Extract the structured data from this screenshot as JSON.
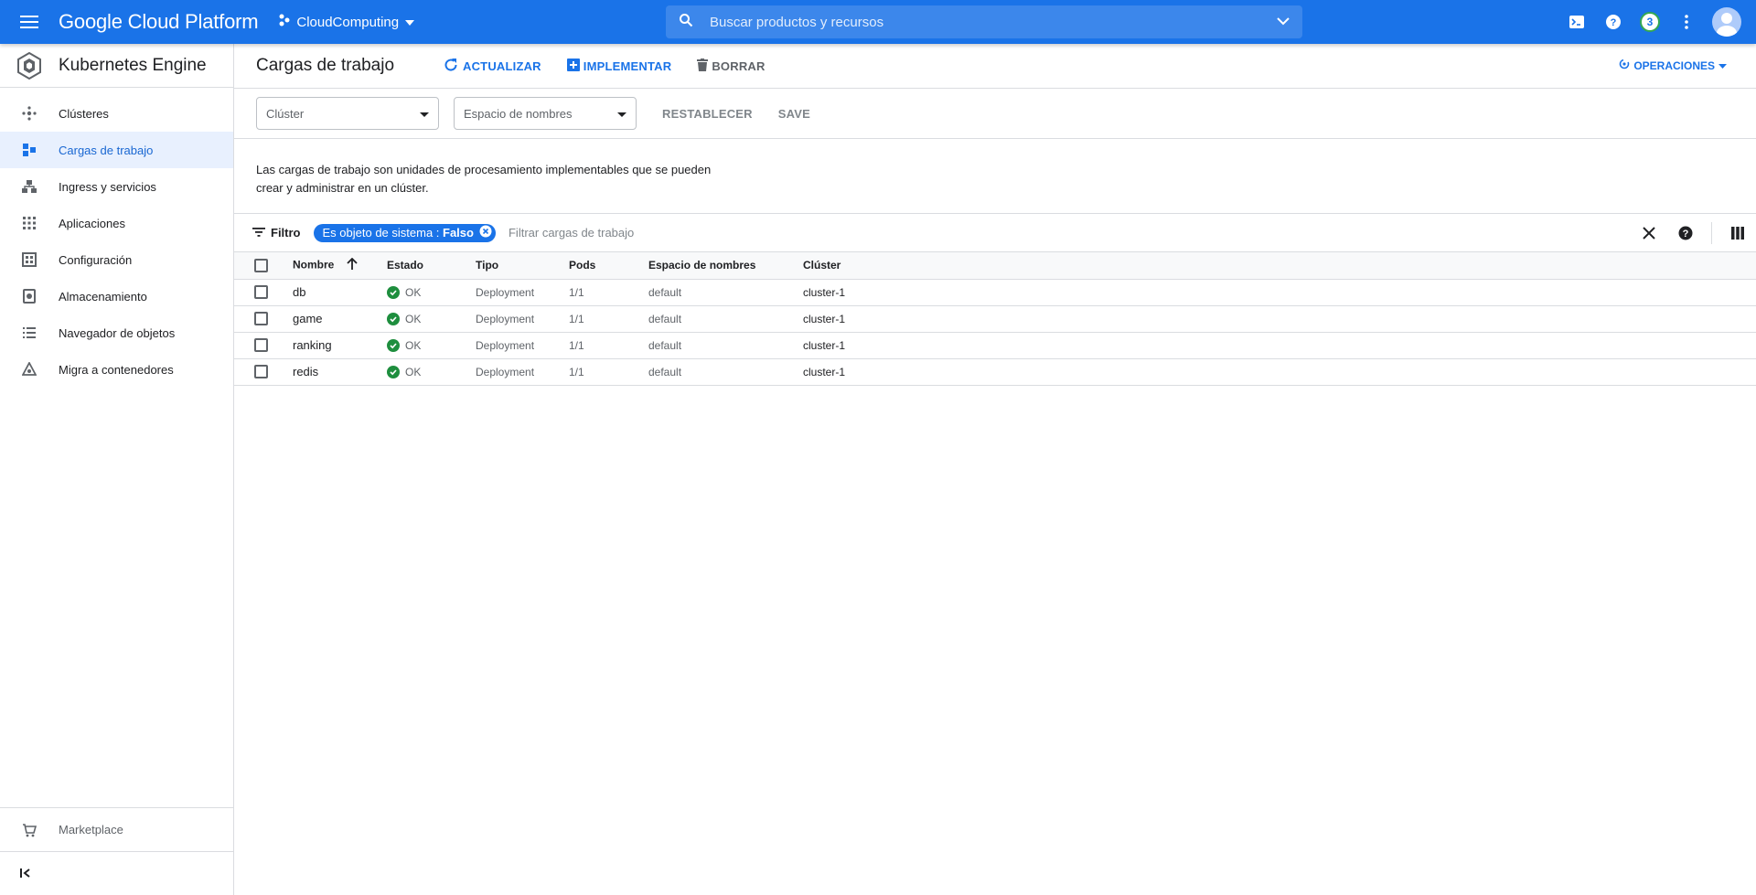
{
  "topbar": {
    "brand": "Google Cloud Platform",
    "project": "CloudComputing",
    "search_placeholder": "Buscar productos y recursos",
    "notification_count": "3"
  },
  "sidebar": {
    "title": "Kubernetes Engine",
    "items": [
      {
        "label": "Clústeres",
        "icon": "clusters-icon"
      },
      {
        "label": "Cargas de trabajo",
        "icon": "workloads-icon",
        "active": true
      },
      {
        "label": "Ingress y servicios",
        "icon": "services-icon"
      },
      {
        "label": "Aplicaciones",
        "icon": "apps-icon"
      },
      {
        "label": "Configuración",
        "icon": "config-icon"
      },
      {
        "label": "Almacenamiento",
        "icon": "storage-icon"
      },
      {
        "label": "Navegador de objetos",
        "icon": "object-browser-icon"
      },
      {
        "label": "Migra a contenedores",
        "icon": "migrate-icon"
      }
    ],
    "marketplace": "Marketplace"
  },
  "toolbar": {
    "title": "Cargas de trabajo",
    "refresh": "ACTUALIZAR",
    "deploy": "IMPLEMENTAR",
    "delete": "BORRAR",
    "operations": "OPERACIONES"
  },
  "filters": {
    "cluster_placeholder": "Clúster",
    "namespace_placeholder": "Espacio de nombres",
    "reset": "RESTABLECER",
    "save": "SAVE"
  },
  "description": "Las cargas de trabajo son unidades de procesamiento implementables que se pueden crear y administrar en un clúster.",
  "filterbar": {
    "label": "Filtro",
    "chip_key": "Es objeto de sistema : ",
    "chip_value": "Falso",
    "input_placeholder": "Filtrar cargas de trabajo"
  },
  "table": {
    "headers": [
      "Nombre",
      "Estado",
      "Tipo",
      "Pods",
      "Espacio de nombres",
      "Clúster"
    ],
    "rows": [
      {
        "name": "db",
        "status": "OK",
        "type": "Deployment",
        "pods": "1/1",
        "namespace": "default",
        "cluster": "cluster-1"
      },
      {
        "name": "game",
        "status": "OK",
        "type": "Deployment",
        "pods": "1/1",
        "namespace": "default",
        "cluster": "cluster-1"
      },
      {
        "name": "ranking",
        "status": "OK",
        "type": "Deployment",
        "pods": "1/1",
        "namespace": "default",
        "cluster": "cluster-1"
      },
      {
        "name": "redis",
        "status": "OK",
        "type": "Deployment",
        "pods": "1/1",
        "namespace": "default",
        "cluster": "cluster-1"
      }
    ]
  },
  "colors": {
    "primary": "#1a73e8",
    "ok": "#1e8e3e",
    "active_bg": "#e8f0fe"
  }
}
